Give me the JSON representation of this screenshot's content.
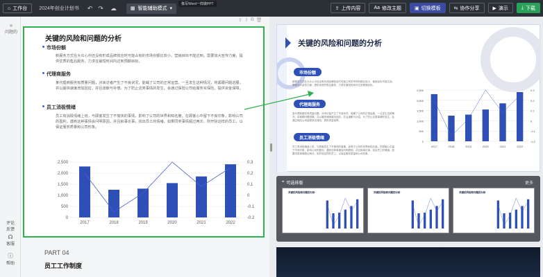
{
  "topbar": {
    "workspace": "工作台",
    "doc_title": "2024年创业计划书",
    "mode": "智能辅助模式",
    "tooltip": "像写Word一样做PPT",
    "upload": "上传内容",
    "theme": "修改主题",
    "switch_template": "切换模板",
    "share": "协作分享",
    "present": "演示",
    "download": "下载"
  },
  "leftrail": {
    "outline": "大纲",
    "section": "问题的",
    "feedback": "反馈",
    "feedback2": "评论",
    "help_group": "客服",
    "help": "帮助"
  },
  "slide": {
    "title": "关键的风险和问题的分析",
    "sections": [
      {
        "heading": "市场份额",
        "text": "新服务方式在大众心中还没有形成品牌效应时可能占有的市场份额比较小，营销目标不能达到。需要加大宣传力度，提供优质的售后服务，力求在最短时间内达到预期目标。"
      },
      {
        "heading": "代理商服务",
        "text": "某代理商服务有质量问题，对来访者产生了不良状况，能蝇了公司的正常运营。一旦发生这种情况，将紧跟问题进展，并以最快速度增加回应，并且道歉与补偿。为了防止这类事情的发生，会通过保险公司给服务买保险，提供资金保障。"
      },
      {
        "heading": "员工消极情绪",
        "text": "员工有消极情绪上班，与顾客发生了不愉快的事情，影响了公司的世界和知名度。在顾客心中留下不良印象，影响公司的盈利。遇到这种事情会问明原因，并且就事论事，找出员工的情绪，如果同类事情超过两次，则开除这样的员工，以保证服务质量和公司形象。"
      }
    ],
    "next_part": "PART 04",
    "next_title": "员工工作制度"
  },
  "chart_data": {
    "type": "bar",
    "categories": [
      "2017",
      "2018",
      "2019",
      "2020",
      "2021",
      "2022"
    ],
    "series": [
      {
        "type": "bar",
        "values": [
          2300,
          1250,
          1300,
          1550,
          1850,
          2400
        ]
      },
      {
        "type": "line",
        "axis": "right",
        "values": [
          0.2,
          -0.15,
          0.02,
          0.3,
          0.08,
          0.25
        ]
      }
    ],
    "ylim": [
      0,
      2500
    ],
    "yticks": [
      "2,500",
      "2,000",
      "1,500",
      "1,000",
      "500",
      "0"
    ],
    "y2lim": [
      -0.2,
      0.3
    ],
    "y2ticks": [
      "0.3",
      "0.2",
      "0.1",
      "0",
      "-0.1",
      "-0.2"
    ],
    "grid": true
  },
  "preview": {
    "title": "关键的风险和问题的分析",
    "badges": [
      "市场份额",
      "代理商服务",
      "员工消极情绪"
    ]
  },
  "layout_panel": {
    "title": "可选排版",
    "more": "更多",
    "thumb_title": "关键的风险和问题的分析"
  },
  "colors": {
    "accent": "#2bb24c",
    "bar": "#2d4fb6",
    "brand": "#3a4aa0"
  }
}
